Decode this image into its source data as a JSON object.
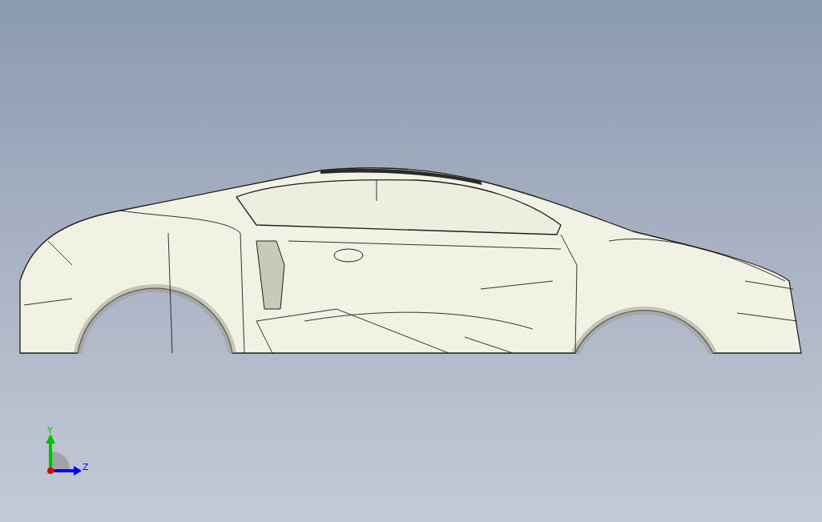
{
  "triad": {
    "axes": [
      {
        "label": "Y",
        "color": "#00c000",
        "kind": "vertical"
      },
      {
        "label": "Z",
        "color": "#0000ff",
        "kind": "horizontal"
      }
    ]
  }
}
